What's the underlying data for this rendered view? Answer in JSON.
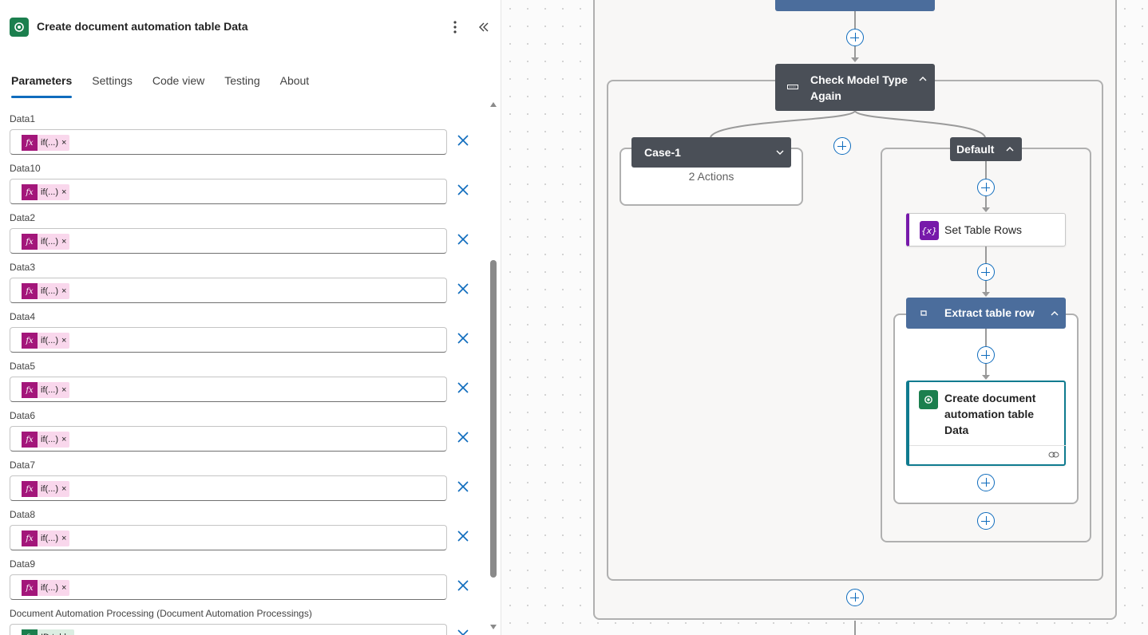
{
  "panel": {
    "title": "Create document automation table Data",
    "tabs": [
      {
        "label": "Parameters",
        "active": true
      },
      {
        "label": "Settings",
        "active": false
      },
      {
        "label": "Code view",
        "active": false
      },
      {
        "label": "Testing",
        "active": false
      },
      {
        "label": "About",
        "active": false
      }
    ],
    "parameters": [
      {
        "label": "Data1",
        "token": "if(...)"
      },
      {
        "label": "Data10",
        "token": "if(...)"
      },
      {
        "label": "Data2",
        "token": "if(...)"
      },
      {
        "label": "Data3",
        "token": "if(...)"
      },
      {
        "label": "Data4",
        "token": "if(...)"
      },
      {
        "label": "Data5",
        "token": "if(...)"
      },
      {
        "label": "Data6",
        "token": "if(...)"
      },
      {
        "label": "Data7",
        "token": "if(...)"
      },
      {
        "label": "Data8",
        "token": "if(...)"
      },
      {
        "label": "Data9",
        "token": "if(...)"
      },
      {
        "label": "Document Automation Processing (Document Automation Processings)",
        "token": "ID table"
      }
    ],
    "token_fx_symbol": "fx",
    "token_remove_glyph": "×"
  },
  "canvas": {
    "check_model": {
      "title": "Check Model Type Again"
    },
    "case1": {
      "title": "Case-1",
      "subtitle": "2 Actions"
    },
    "default_case": {
      "title": "Default"
    },
    "set_table_rows": {
      "title": "Set Table Rows",
      "icon_text": "{x}"
    },
    "extract_table_row": {
      "title": "Extract table row"
    },
    "create_doc": {
      "title": "Create document automation table Data"
    }
  },
  "colors": {
    "accent": "#0f6cbd",
    "token_fx": "#a3167a",
    "token_bg": "#f9d7ec",
    "dataverse_green": "#1b7f4e",
    "variable_purple": "#7719aa",
    "dark_node": "#4a4f57",
    "loop_node": "#4b6d9c"
  },
  "icons": {
    "app": "dataverse-icon",
    "more": "more-vertical-icon",
    "collapse": "double-chevron-left-icon",
    "remove": "close-icon",
    "fx": "fx-icon",
    "switch": "switch-icon",
    "loop": "loop-icon",
    "variable": "variable-icon",
    "link": "link-icon"
  }
}
